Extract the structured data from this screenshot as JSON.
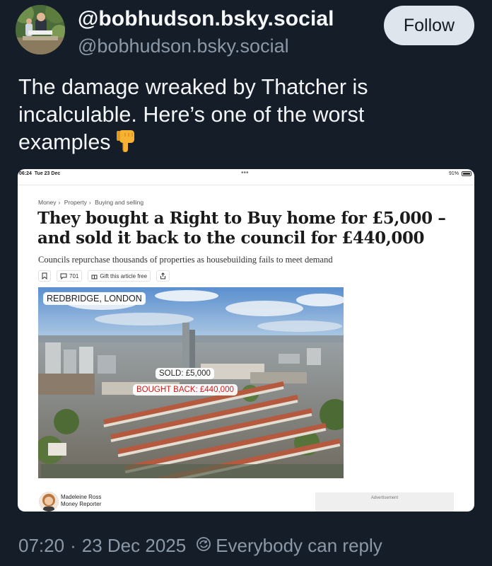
{
  "author": {
    "display_name": "@bobhudson.bsky.social",
    "handle": "@bobhudson.bsky.social",
    "follow_label": "Follow"
  },
  "post": {
    "text_line1": "The damage wreaked by Thatcher is",
    "text_line2": "incalculable. Here’s one of the worst",
    "text_line3": "examples",
    "emoji": "point-down-icon"
  },
  "embed": {
    "status_time": "06:24",
    "status_date": "Tue 23 Dec",
    "status_dots": "•••",
    "battery": "91%",
    "breadcrumb": [
      "Money",
      "Property",
      "Buying and selling"
    ],
    "headline_line1": "They bought a Right to Buy home for £5,000 –",
    "headline_line2": "and sold it back to the council for £440,000",
    "standfirst": "Councils repurchase thousands of properties as housebuilding fails to meet demand",
    "comments_count": "701",
    "gift_label": "Gift this article free",
    "photo_location": "REDBRIDGE, LONDON",
    "photo_sold": "SOLD: £5,000",
    "photo_bought": "BOUGHT BACK: £440,000",
    "author_name": "Madeleine Ross",
    "author_role": "Money Reporter",
    "ad_label": "Advertisement"
  },
  "footer": {
    "time": "07:20",
    "date": "23 Dec 2025",
    "reply_setting": "Everybody can reply"
  },
  "colors": {
    "background": "#151d28",
    "muted_text": "#8b98a8",
    "follow_button_bg": "#dfe5ec",
    "bought_back_red": "#d21a1a"
  }
}
